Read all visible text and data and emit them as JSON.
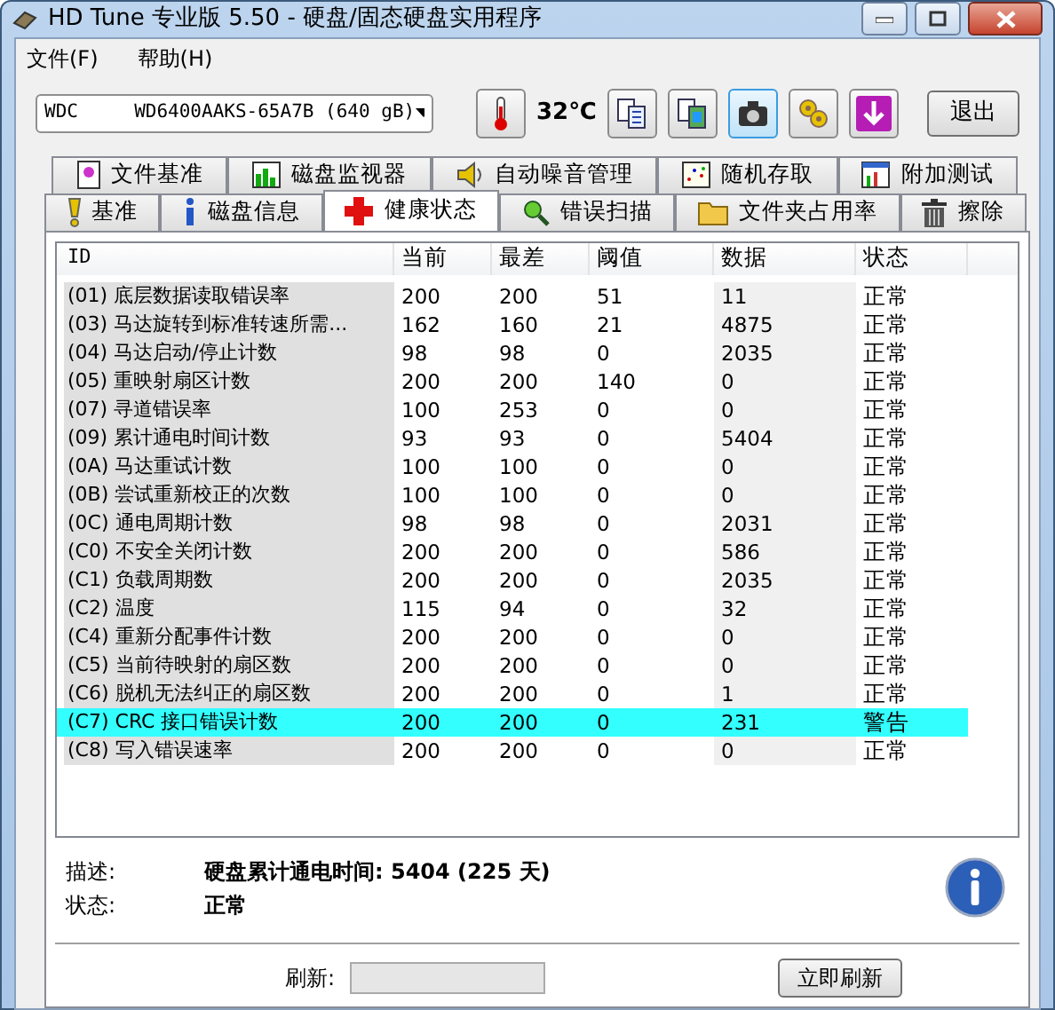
{
  "window": {
    "title": "HD Tune 专业版 5.50 - 硬盘/固态硬盘实用程序"
  },
  "menu": [
    "文件(F)",
    "帮助(H)"
  ],
  "toolbar": {
    "drive": "WDC     WD6400AAKS-65A7B (640 gB)",
    "temperature": "32℃",
    "tool_buttons": [
      {
        "selected": false
      },
      {
        "selected": false
      },
      {
        "selected": true
      },
      {
        "selected": false
      },
      {
        "selected": false
      }
    ],
    "exit_button": "退出"
  },
  "tab_rows": [
    [
      {
        "label": "文件基准",
        "selected": false
      },
      {
        "label": "磁盘监视器",
        "selected": false
      },
      {
        "label": "自动噪音管理",
        "selected": false
      },
      {
        "label": "随机存取",
        "selected": false
      },
      {
        "label": "附加测试",
        "selected": false
      }
    ],
    [
      {
        "label": "基准",
        "selected": false
      },
      {
        "label": "磁盘信息",
        "selected": false
      },
      {
        "label": "健康状态",
        "selected": true
      },
      {
        "label": "错误扫描",
        "selected": false
      },
      {
        "label": "文件夹占用率",
        "selected": false
      },
      {
        "label": "擦除",
        "selected": false
      }
    ]
  ],
  "table": {
    "columns": [
      "ID",
      "当前",
      "最差",
      "阈值",
      "数据",
      "状态"
    ],
    "rows": [
      {
        "name": "(01) 底层数据读取错误率",
        "current": "200",
        "worst": "200",
        "threshold": "51",
        "data": "11",
        "status": "正常",
        "selected": false
      },
      {
        "name": "(03) 马达旋转到标准转速所需...",
        "current": "162",
        "worst": "160",
        "threshold": "21",
        "data": "4875",
        "status": "正常",
        "selected": false
      },
      {
        "name": "(04) 马达启动/停止计数",
        "current": "98",
        "worst": "98",
        "threshold": "0",
        "data": "2035",
        "status": "正常",
        "selected": false
      },
      {
        "name": "(05) 重映射扇区计数",
        "current": "200",
        "worst": "200",
        "threshold": "140",
        "data": "0",
        "status": "正常",
        "selected": false
      },
      {
        "name": "(07) 寻道错误率",
        "current": "100",
        "worst": "253",
        "threshold": "0",
        "data": "0",
        "status": "正常",
        "selected": false
      },
      {
        "name": "(09) 累计通电时间计数",
        "current": "93",
        "worst": "93",
        "threshold": "0",
        "data": "5404",
        "status": "正常",
        "selected": false
      },
      {
        "name": "(0A) 马达重试计数",
        "current": "100",
        "worst": "100",
        "threshold": "0",
        "data": "0",
        "status": "正常",
        "selected": false
      },
      {
        "name": "(0B) 尝试重新校正的次数",
        "current": "100",
        "worst": "100",
        "threshold": "0",
        "data": "0",
        "status": "正常",
        "selected": false
      },
      {
        "name": "(0C) 通电周期计数",
        "current": "98",
        "worst": "98",
        "threshold": "0",
        "data": "2031",
        "status": "正常",
        "selected": false
      },
      {
        "name": "(C0) 不安全关闭计数",
        "current": "200",
        "worst": "200",
        "threshold": "0",
        "data": "586",
        "status": "正常",
        "selected": false
      },
      {
        "name": "(C1) 负载周期数",
        "current": "200",
        "worst": "200",
        "threshold": "0",
        "data": "2035",
        "status": "正常",
        "selected": false
      },
      {
        "name": "(C2) 温度",
        "current": "115",
        "worst": "94",
        "threshold": "0",
        "data": "32",
        "status": "正常",
        "selected": false
      },
      {
        "name": "(C4) 重新分配事件计数",
        "current": "200",
        "worst": "200",
        "threshold": "0",
        "data": "0",
        "status": "正常",
        "selected": false
      },
      {
        "name": "(C5) 当前待映射的扇区数",
        "current": "200",
        "worst": "200",
        "threshold": "0",
        "data": "0",
        "status": "正常",
        "selected": false
      },
      {
        "name": "(C6) 脱机无法纠正的扇区数",
        "current": "200",
        "worst": "200",
        "threshold": "0",
        "data": "1",
        "status": "正常",
        "selected": false
      },
      {
        "name": "(C7) CRC 接口错误计数",
        "current": "200",
        "worst": "200",
        "threshold": "0",
        "data": "231",
        "status": "警告",
        "selected": true
      },
      {
        "name": "(C8) 写入错误速率",
        "current": "200",
        "worst": "200",
        "threshold": "0",
        "data": "0",
        "status": "正常",
        "selected": false
      }
    ]
  },
  "details": [
    {
      "label": "描述:",
      "value": "硬盘累计通电时间: 5404 (225 天)"
    },
    {
      "label": "状态:",
      "value": "正常"
    }
  ],
  "bottom_bar": {
    "refresh_label": "刷新:",
    "refresh_button": "立即刷新"
  }
}
